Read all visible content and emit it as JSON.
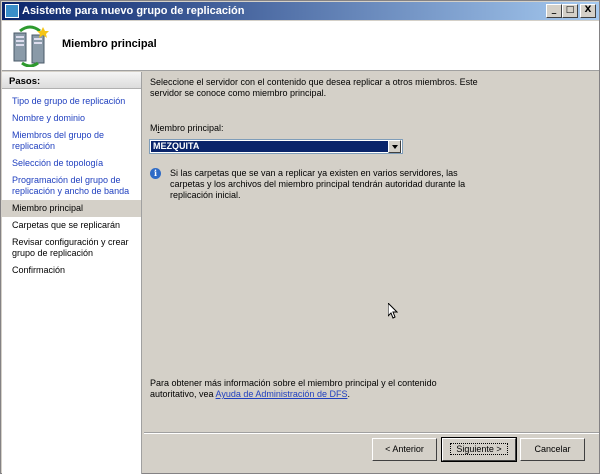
{
  "window": {
    "title": "Asistente para nuevo grupo de replicación",
    "minimize_label": "_",
    "maximize_label": "□",
    "close_label": "X"
  },
  "header": {
    "title": "Miembro principal"
  },
  "sidebar": {
    "heading": "Pasos:",
    "steps": [
      {
        "label": "Tipo de grupo de replicación"
      },
      {
        "label": "Nombre y dominio"
      },
      {
        "label": "Miembros del grupo de replicación"
      },
      {
        "label": "Selección de topología"
      },
      {
        "label": "Programación del grupo de replicación y ancho de banda"
      },
      {
        "label": "Miembro principal"
      },
      {
        "label": "Carpetas que se replicarán"
      },
      {
        "label": "Revisar configuración y crear grupo de replicación"
      },
      {
        "label": "Confirmación"
      }
    ]
  },
  "content": {
    "intro": "Seleccione el servidor con el contenido que desea replicar a otros miembros. Este servidor se conoce como miembro principal.",
    "field_label_prefix": "M",
    "field_label_underlined": "i",
    "field_label_suffix": "embro principal:",
    "selected_member": "MEZQUITA",
    "info_text": "Si las carpetas que se van a replicar ya existen en varios servidores, las carpetas y los archivos del miembro principal tendrán autoridad durante la replicación inicial.",
    "more_info_prefix": "Para obtener más información sobre el miembro principal y el contenido autoritativo, vea ",
    "more_info_link": "Ayuda de Administración de DFS",
    "more_info_suffix": "."
  },
  "buttons": {
    "back": "< Anterior",
    "next": "Siguiente >",
    "cancel": "Cancelar"
  }
}
